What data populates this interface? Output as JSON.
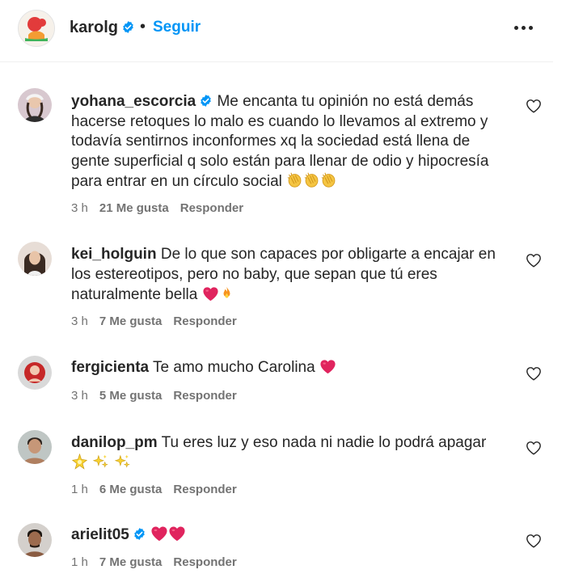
{
  "post_header": {
    "username": "karolg",
    "separator": "•",
    "follow_label": "Seguir"
  },
  "comments": [
    {
      "username": "yohana_escorcia",
      "verified": true,
      "text": "Me encanta tu opinión no está demás hacerse retoques lo malo es cuando lo llevamos al extremo y todavía sentirnos inconformes xq la sociedad está llena de gente superficial q solo están para llenar de odio y hipocresía para entrar en un círculo social",
      "emojis": [
        "clapping-hands",
        "clapping-hands",
        "clapping-hands"
      ],
      "time": "3 h",
      "likes": "21 Me gusta",
      "reply_label": "Responder"
    },
    {
      "username": "kei_holguin",
      "verified": false,
      "text": "De lo que son capaces por obligarte a encajar en los estereotipos, pero no baby, que sepan que tú eres naturalmente bella",
      "emojis": [
        "red-heart",
        "fire"
      ],
      "time": "3 h",
      "likes": "7 Me gusta",
      "reply_label": "Responder"
    },
    {
      "username": "fergicienta",
      "verified": false,
      "text": "Te amo mucho Carolina",
      "emojis": [
        "red-heart"
      ],
      "time": "3 h",
      "likes": "5 Me gusta",
      "reply_label": "Responder"
    },
    {
      "username": "danilop_pm",
      "verified": false,
      "text": "Tu eres luz y eso nada ni nadie lo podrá apagar",
      "emojis": [
        "sparkle",
        "sparkles",
        "sparkles"
      ],
      "time": "1 h",
      "likes": "6 Me gusta",
      "reply_label": "Responder"
    },
    {
      "username": "arielit05",
      "verified": true,
      "text": "",
      "emojis": [
        "red-heart",
        "red-heart"
      ],
      "time": "1 h",
      "likes": "7 Me gusta",
      "reply_label": "Responder"
    }
  ],
  "colors": {
    "link_blue": "#0095f6",
    "verified_blue": "#0095f6",
    "muted_text": "#737373",
    "heart_red": "#e0245e"
  }
}
